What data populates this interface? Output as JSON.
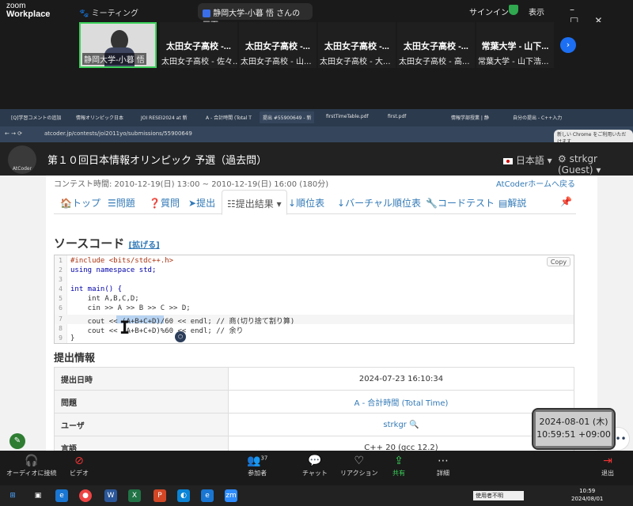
{
  "zoom": {
    "logo_line1": "zoom",
    "logo_line2": "Workplace",
    "meeting_label": "ミーティング",
    "share_label": "静岡大学-小暮 悟 さんの画面",
    "signin": "サインイン",
    "view": "表示",
    "tiles": [
      {
        "title": "",
        "sub": "静岡大学-小暮 悟"
      },
      {
        "title": "太田女子高校 -...",
        "sub": "太田女子高校 - 佐々..."
      },
      {
        "title": "太田女子高校 -...",
        "sub": "太田女子高校 - 山..."
      },
      {
        "title": "太田女子高校 -...",
        "sub": "太田女子高校 - 大..."
      },
      {
        "title": "太田女子高校 -...",
        "sub": "太田女子高校 - 高..."
      },
      {
        "title": "常葉大学 - 山下...",
        "sub": "常葉大学 - 山下浩..."
      }
    ],
    "bottom": {
      "audio": "オーディオに接続",
      "video": "ビデオ",
      "participants": "参加者",
      "participants_count": "37",
      "chat": "チャット",
      "reaction": "リアクション",
      "share": "共有",
      "details": "詳細",
      "leave": "退出"
    },
    "clock_date": "2024-08-01 (木)",
    "clock_time": "10:59:51 +09:00"
  },
  "browser": {
    "tabs": [
      "[Q]学習コメントの追加",
      "情報オリンピック日本",
      "JOI RESEI2024 at 新",
      "A - 合計時間 (Total T",
      "提出 #55900649 - 新",
      "firstTimeTable.pdf",
      "first.pdf",
      "情報学部授業 | 静",
      "自分の提出 - C++入力"
    ],
    "url": "atcoder.jp/contests/joi2011yo/submissions/55900649",
    "notice": "新しい Chrome をご利用いただけます"
  },
  "atcoder": {
    "logo": "AtCoder",
    "title": "第１０回日本情報オリンピック 予選（過去問）",
    "lang": "日本語",
    "user": "strkgr (Guest)",
    "period": "コンテスト時間: 2010-12-19(日) 13:00 ~ 2010-12-19(日) 16:00 (180分)",
    "home_link": "AtCoderホームへ戻る",
    "tabs": [
      "トップ",
      "問題",
      "質問",
      "提出",
      "提出結果",
      "順位表",
      "バーチャル順位表",
      "コードテスト",
      "解説"
    ],
    "source_heading": "ソースコード",
    "expand": "[拡げる]",
    "copy": "Copy",
    "code_lines": [
      "#include <bits/stdc++.h>",
      "using namespace std;",
      "",
      "int main() {",
      "    int A,B,C,D;",
      "    cin >> A >> B >> C >> D;",
      "    cout << (A+B+C+D)/60 << endl; // 商(切り捨て割り算)",
      "    cout << (A+B+C+D)%60 << endl; // 余り",
      "}"
    ],
    "submission_heading": "提出情報",
    "rows": [
      {
        "label": "提出日時",
        "value": "2024-07-23 16:10:34"
      },
      {
        "label": "問題",
        "value": "A - 合計時間 (Total Time)"
      },
      {
        "label": "ユーザ",
        "value": "strkgr"
      },
      {
        "label": "言語",
        "value": "C++ 20 (gcc 12.2)"
      }
    ]
  },
  "taskbar": {
    "search": "使用者不明",
    "time": "10:59",
    "date": "2024/08/01"
  }
}
